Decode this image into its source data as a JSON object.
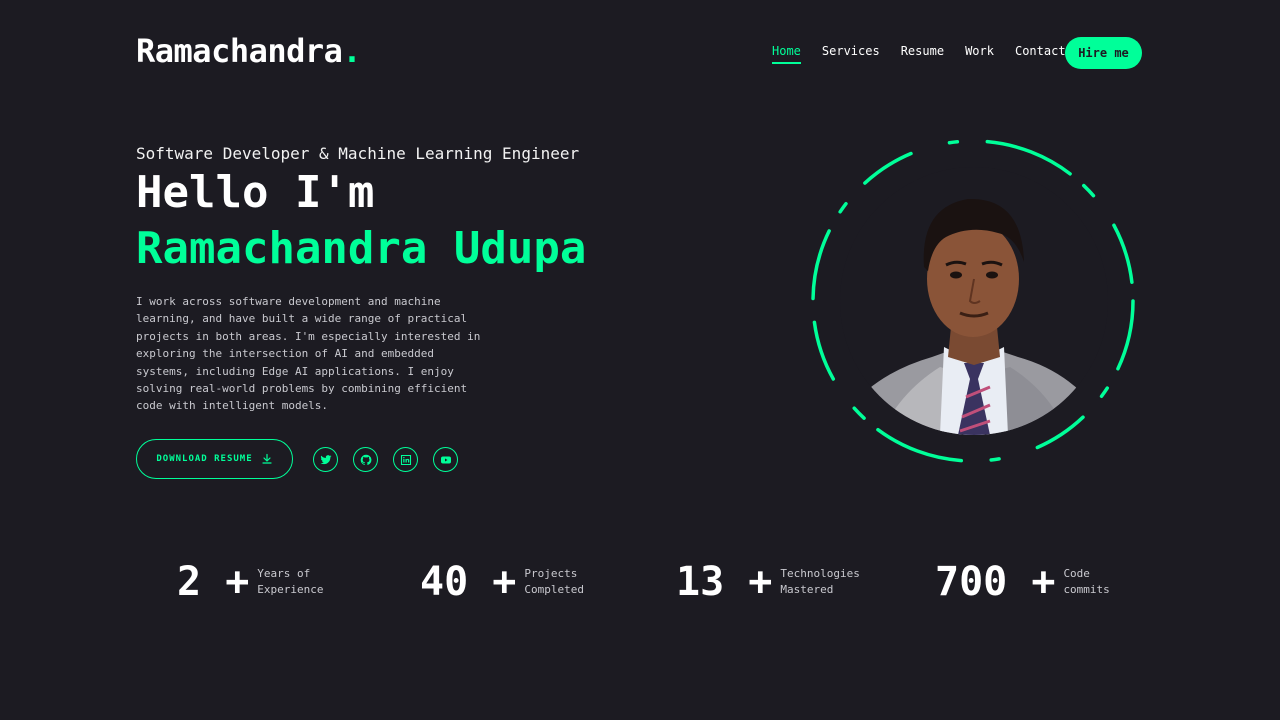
{
  "brand": {
    "name": "Ramachandra",
    "dot": "."
  },
  "nav": {
    "items": [
      {
        "label": "Home",
        "active": true
      },
      {
        "label": "Services",
        "active": false
      },
      {
        "label": "Resume",
        "active": false
      },
      {
        "label": "Work",
        "active": false
      },
      {
        "label": "Contact",
        "active": false
      }
    ],
    "hire_label": "Hire me"
  },
  "hero": {
    "subtitle": "Software Developer & Machine Learning Engineer",
    "greeting": "Hello I'm",
    "name": "Ramachandra Udupa",
    "description": "I work across software development and machine learning, and have built a wide range of practical projects in both areas. I'm especially interested in exploring the intersection of AI and embedded systems, including Edge AI applications. I enjoy solving real-world problems by combining efficient code with intelligent models.",
    "resume_label": "DOWNLOAD RESUME",
    "socials": [
      "twitter-icon",
      "github-icon",
      "linkedin-icon",
      "youtube-icon"
    ]
  },
  "stats": [
    {
      "value": "2",
      "plus": "+",
      "label": "Years of Experience"
    },
    {
      "value": "40",
      "plus": "+",
      "label": "Projects Completed"
    },
    {
      "value": "13",
      "plus": "+",
      "label": "Technologies Mastered"
    },
    {
      "value": "700",
      "plus": "+",
      "label": "Code commits"
    }
  ],
  "colors": {
    "accent": "#00ff99",
    "background": "#1c1b22",
    "text": "#ffffff"
  }
}
